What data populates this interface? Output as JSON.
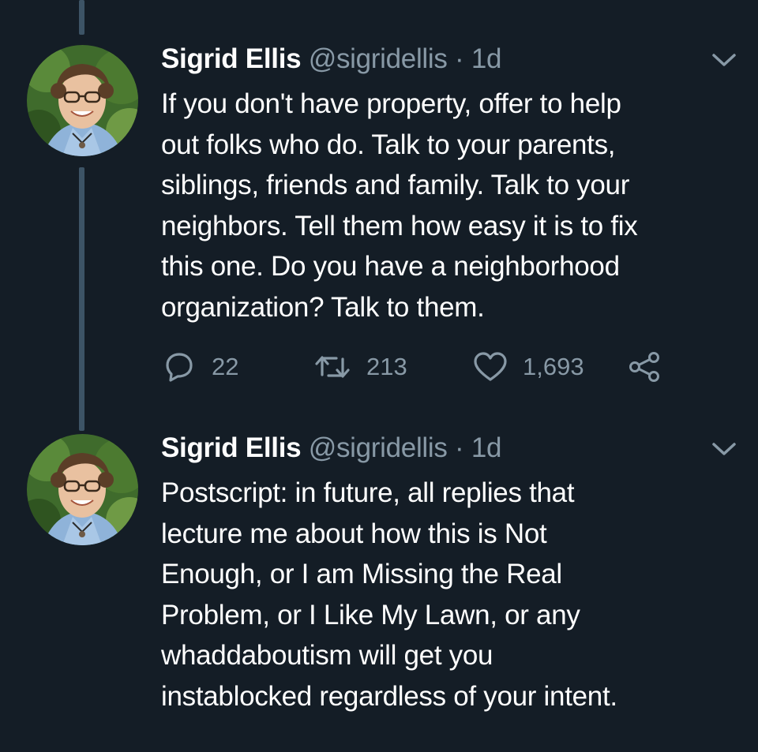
{
  "tweets": [
    {
      "author_name": "Sigrid Ellis",
      "handle": "@sigridellis",
      "separator": "·",
      "time": "1d",
      "text_lines": [
        "If you don't have property, offer to help",
        "out folks who do. Talk to your parents,",
        "siblings, friends and family. Talk to your",
        "neighbors. Tell them how easy it is to fix",
        "this one. Do you have a neighborhood",
        "organization? Talk to them."
      ],
      "reply_count": "22",
      "retweet_count": "213",
      "like_count": "1,693"
    },
    {
      "author_name": "Sigrid Ellis",
      "handle": "@sigridellis",
      "separator": "·",
      "time": "1d",
      "text_lines": [
        "Postscript: in future, all replies that",
        "lecture me about how this is Not",
        "Enough, or I am Missing the Real",
        "Problem, or I Like My Lawn, or any",
        "whaddaboutism will get you",
        "instablocked regardless of your intent."
      ]
    }
  ],
  "icons": {
    "reply": "reply-icon",
    "retweet": "retweet-icon",
    "like": "heart-icon",
    "share": "share-icon",
    "more": "chevron-down-icon"
  },
  "colors": {
    "background": "#141d26",
    "primary_text": "#ffffff",
    "secondary_text": "#8899a6",
    "thread_line": "#3d5466"
  }
}
